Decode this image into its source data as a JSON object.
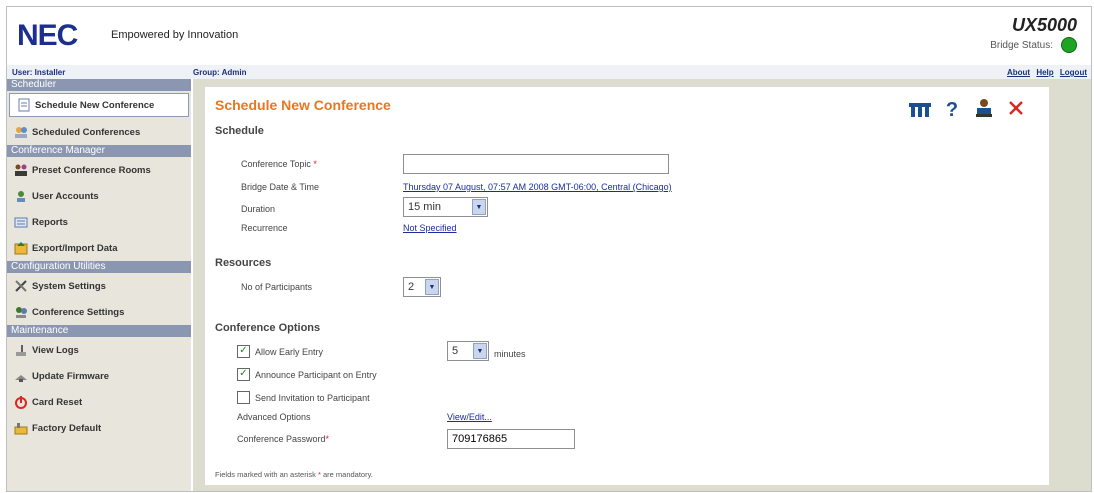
{
  "header": {
    "logo": "NEC",
    "tagline": "Empowered by Innovation",
    "product": "UX5000",
    "bridge_status_label": "Bridge Status:"
  },
  "infobar": {
    "user": "User: Installer",
    "group": "Group: Admin",
    "links": [
      "About",
      "Help",
      "Logout"
    ]
  },
  "sidebar": {
    "sections": [
      {
        "title": "Scheduler",
        "items": [
          "Schedule New Conference",
          "Scheduled Conferences"
        ]
      },
      {
        "title": "Conference Manager",
        "items": [
          "Preset Conference Rooms",
          "User Accounts",
          "Reports",
          "Export/Import Data"
        ]
      },
      {
        "title": "Configuration Utilities",
        "items": [
          "System Settings",
          "Conference Settings"
        ]
      },
      {
        "title": "Maintenance",
        "items": [
          "View Logs",
          "Update Firmware",
          "Card Reset",
          "Factory Default"
        ]
      }
    ]
  },
  "panel": {
    "title": "Schedule New Conference",
    "schedule_heading": "Schedule",
    "topic_label": "Conference Topic",
    "topic_value": "",
    "bridge_dt_label": "Bridge Date & Time",
    "bridge_dt_value": "Thursday 07 August, 07:57 AM 2008 GMT-06:00, Central (Chicago)",
    "duration_label": "Duration",
    "duration_value": "15 min",
    "recurrence_label": "Recurrence",
    "recurrence_value": "Not Specified",
    "resources_heading": "Resources",
    "participants_label": "No of Participants",
    "participants_value": "2",
    "options_heading": "Conference Options",
    "early_entry_label": "Allow Early Entry",
    "early_entry_minutes": "5",
    "minutes_label": "minutes",
    "announce_label": "Announce Participant on Entry",
    "invite_label": "Send Invitation to Participant",
    "advanced_label": "Advanced Options",
    "advanced_link": "View/Edit...",
    "password_label": "Conference Password",
    "password_value": "709176865",
    "footnote_pre": "Fields marked with an asterisk",
    "footnote_post": "are mandatory."
  },
  "colors": {
    "accent": "#e87722",
    "brand_blue": "#1c2f8f",
    "status_ok": "#1fa324"
  }
}
